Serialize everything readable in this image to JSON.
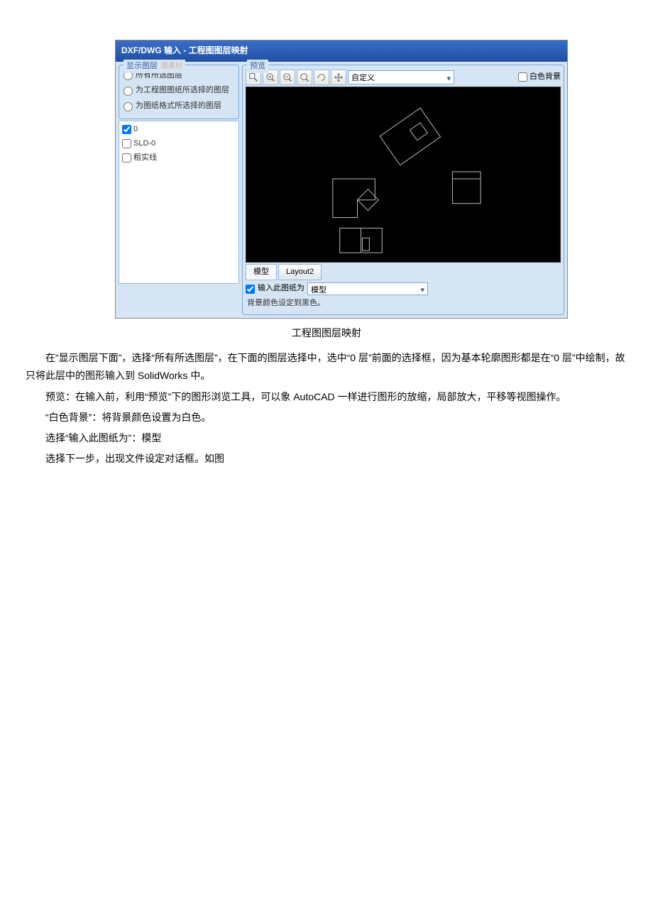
{
  "dialog": {
    "title": "DXF/DWG 输入 - 工程图图层映射",
    "left": {
      "group_title": "显示图层",
      "watermark": "酷素材",
      "radios": {
        "all": "所有所选图层",
        "drawing": "为工程图图纸所选择的图层",
        "format": "为图纸格式所选择的图层"
      },
      "layers": [
        "0",
        "SLD-0",
        "粗实线"
      ]
    },
    "preview": {
      "group_title": "预览",
      "zoom_select": "自定义",
      "white_bg": "白色背景",
      "tabs": [
        "模型",
        "Layout2"
      ],
      "import_check": "输入此图纸为",
      "import_select": "模型",
      "bg_note": "背景颜色设定到黑色。"
    }
  },
  "caption": "工程图图层映射",
  "paragraphs": [
    "在“显示图层下面”，选择“所有所选图层”，在下面的图层选择中，选中“0 层”前面的选择框，因为基本轮廓图形都是在“0 层”中绘制，故只将此层中的图形输入到 SolidWorks 中。",
    "预览：在输入前，利用“预览”下的图形浏览工具，可以象 AutoCAD 一样进行图形的放缩，局部放大，平移等视图操作。",
    "“白色背景”：将背景颜色设置为白色。",
    "选择“输入此图纸为”：模型",
    "选择下一步，出现文件设定对话框。如图"
  ]
}
